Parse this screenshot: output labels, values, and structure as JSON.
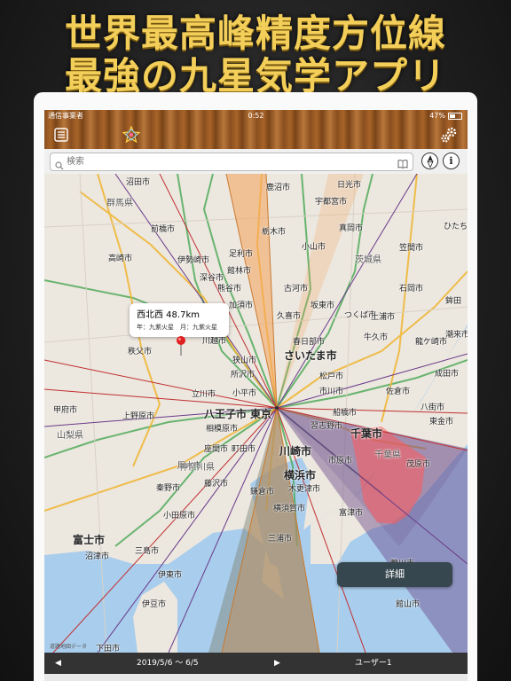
{
  "promo": {
    "line1": "世界最高峰精度方位線",
    "line2": "最強の九星気学アプリ",
    "color": "#f3cf5a"
  },
  "status_bar": {
    "carrier": "通信事業者",
    "time": "0:52",
    "battery": "47%"
  },
  "toolbar": {
    "menu_icon": "list-icon",
    "center_icon": "nine-star-icon",
    "settings_icon": "gear-icon"
  },
  "search": {
    "placeholder": "検索",
    "value": ""
  },
  "map": {
    "labels": [
      {
        "text": "沼田市",
        "cls": ""
      },
      {
        "text": "日光市",
        "cls": ""
      },
      {
        "text": "群馬県",
        "cls": "pref"
      },
      {
        "text": "鹿沼市",
        "cls": ""
      },
      {
        "text": "宇都宮市",
        "cls": ""
      },
      {
        "text": "前橋市",
        "cls": ""
      },
      {
        "text": "栃木市",
        "cls": ""
      },
      {
        "text": "真岡市",
        "cls": ""
      },
      {
        "text": "ひたち",
        "cls": ""
      },
      {
        "text": "高崎市",
        "cls": ""
      },
      {
        "text": "伊勢崎市",
        "cls": ""
      },
      {
        "text": "足利市",
        "cls": ""
      },
      {
        "text": "小山市",
        "cls": ""
      },
      {
        "text": "笠間市",
        "cls": ""
      },
      {
        "text": "館林市",
        "cls": ""
      },
      {
        "text": "茨城県",
        "cls": "pref"
      },
      {
        "text": "深谷市",
        "cls": ""
      },
      {
        "text": "熊谷市",
        "cls": ""
      },
      {
        "text": "古河市",
        "cls": ""
      },
      {
        "text": "石岡市",
        "cls": ""
      },
      {
        "text": "加須市",
        "cls": ""
      },
      {
        "text": "坂東市",
        "cls": ""
      },
      {
        "text": "鉾田",
        "cls": ""
      },
      {
        "text": "久喜市",
        "cls": ""
      },
      {
        "text": "つくば市",
        "cls": ""
      },
      {
        "text": "土浦市",
        "cls": ""
      },
      {
        "text": "潮来市",
        "cls": ""
      },
      {
        "text": "秩父市",
        "cls": ""
      },
      {
        "text": "川越市",
        "cls": ""
      },
      {
        "text": "春日部市",
        "cls": ""
      },
      {
        "text": "牛久市",
        "cls": ""
      },
      {
        "text": "龍ケ崎市",
        "cls": ""
      },
      {
        "text": "さいたま市",
        "cls": "big"
      },
      {
        "text": "狭山市",
        "cls": ""
      },
      {
        "text": "所沢市",
        "cls": ""
      },
      {
        "text": "松戸市",
        "cls": ""
      },
      {
        "text": "成田市",
        "cls": ""
      },
      {
        "text": "佐倉市",
        "cls": ""
      },
      {
        "text": "市川市",
        "cls": ""
      },
      {
        "text": "立川市",
        "cls": ""
      },
      {
        "text": "小平市",
        "cls": ""
      },
      {
        "text": "八街市",
        "cls": ""
      },
      {
        "text": "甲府市",
        "cls": ""
      },
      {
        "text": "上野原市",
        "cls": ""
      },
      {
        "text": "船橋市",
        "cls": ""
      },
      {
        "text": "八王子市",
        "cls": "big"
      },
      {
        "text": "東京",
        "cls": "big"
      },
      {
        "text": "習志野市",
        "cls": ""
      },
      {
        "text": "東金市",
        "cls": ""
      },
      {
        "text": "相模原市",
        "cls": ""
      },
      {
        "text": "千葉市",
        "cls": "big"
      },
      {
        "text": "山梨県",
        "cls": "pref"
      },
      {
        "text": "座間市",
        "cls": ""
      },
      {
        "text": "町田市",
        "cls": ""
      },
      {
        "text": "川崎市",
        "cls": "big"
      },
      {
        "text": "千葉県",
        "cls": "pref"
      },
      {
        "text": "厚木市",
        "cls": ""
      },
      {
        "text": "市原市",
        "cls": ""
      },
      {
        "text": "茂原市",
        "cls": ""
      },
      {
        "text": "神奈川県",
        "cls": "pref"
      },
      {
        "text": "横浜市",
        "cls": "big"
      },
      {
        "text": "秦野市",
        "cls": ""
      },
      {
        "text": "藤沢市",
        "cls": ""
      },
      {
        "text": "木更津市",
        "cls": ""
      },
      {
        "text": "鎌倉市",
        "cls": ""
      },
      {
        "text": "横須賀市",
        "cls": ""
      },
      {
        "text": "富津市",
        "cls": ""
      },
      {
        "text": "小田原市",
        "cls": ""
      },
      {
        "text": "富士市",
        "cls": "big"
      },
      {
        "text": "三浦市",
        "cls": ""
      },
      {
        "text": "三島市",
        "cls": ""
      },
      {
        "text": "沼津市",
        "cls": ""
      },
      {
        "text": "鴨川市",
        "cls": ""
      },
      {
        "text": "伊東市",
        "cls": ""
      },
      {
        "text": "館山市",
        "cls": ""
      },
      {
        "text": "伊豆市",
        "cls": ""
      },
      {
        "text": "下田市",
        "cls": ""
      }
    ],
    "callout": {
      "title": "西北西 48.7km",
      "subtitle": "年：九紫火星　月：九紫火星"
    },
    "detail_button": "詳細",
    "credit": "道路地図データ"
  },
  "bottom_bar": {
    "prev": "◀",
    "date_range": "2019/5/6 〜 6/5",
    "next": "▶",
    "user": "ユーザー1"
  },
  "colors": {
    "sector_orange": "#f5a25a",
    "sector_red": "#ff5a5a",
    "sector_purple": "#6b4a8a",
    "sector_gray": "#7a8070",
    "toolbar_wood": "#9a5a24"
  }
}
